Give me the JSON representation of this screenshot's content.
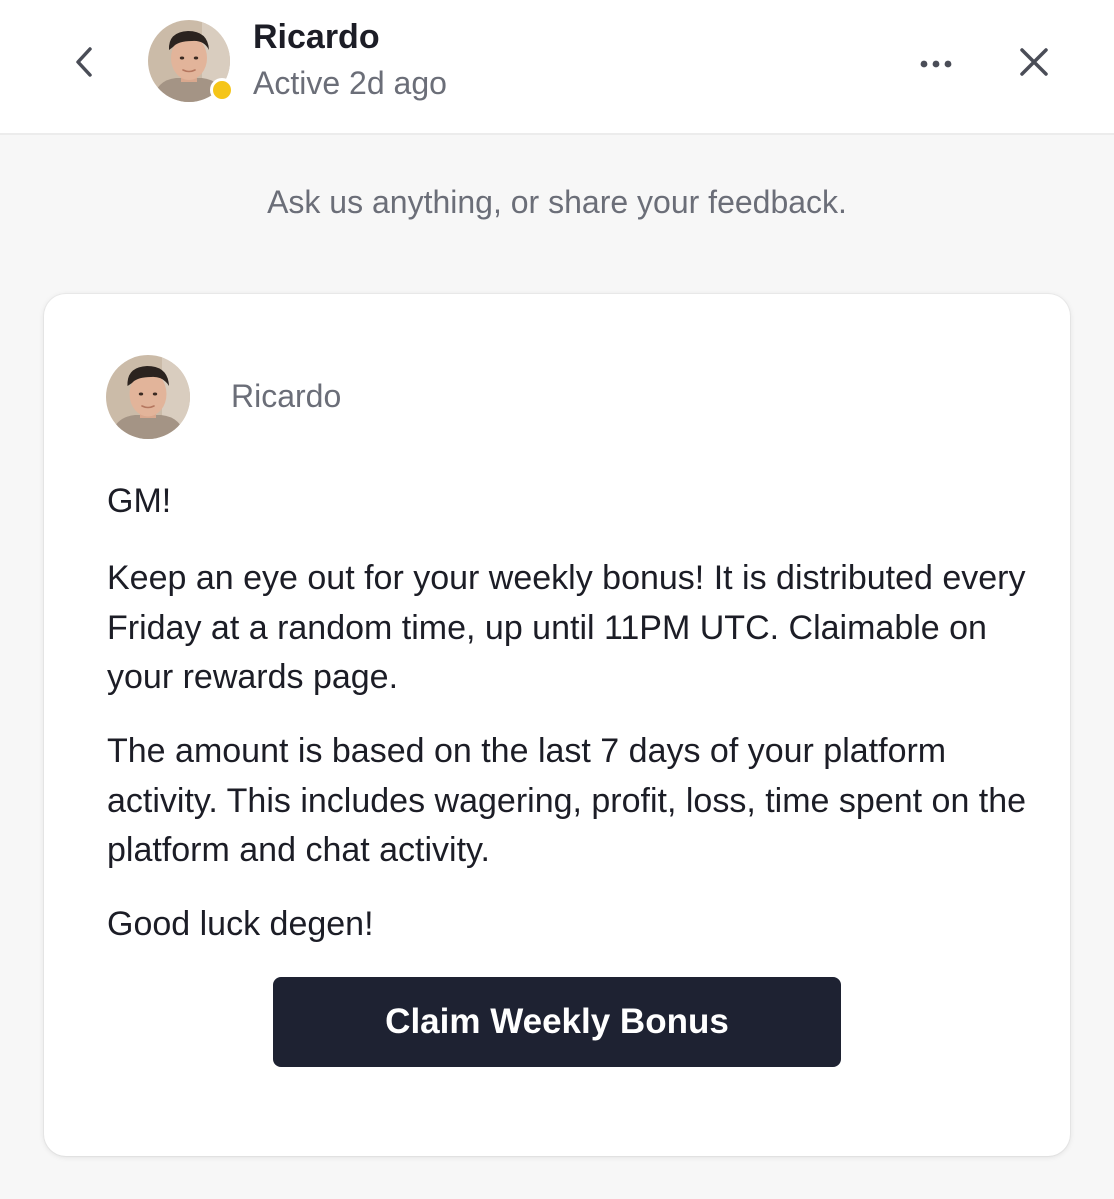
{
  "header": {
    "agent_name": "Ricardo",
    "agent_status": "Active 2d ago",
    "status_color": "#f5c518"
  },
  "intro_text": "Ask us anything, or share your feedback.",
  "message": {
    "author": "Ricardo",
    "paragraphs": [
      "GM!",
      "Keep an eye out for your weekly bonus! It is distributed every Friday at a random time, up until 11PM UTC. Claimable on your rewards page.",
      "The amount is based on the last 7 days of your platform activity. This includes wagering, profit, loss, time spent on the platform and chat activity.",
      "Good luck degen!"
    ],
    "button_label": "Claim Weekly Bonus",
    "button_color": "#1e2232"
  },
  "icons": {
    "back": "chevron-left-icon",
    "more": "ellipsis-icon",
    "close": "close-icon"
  }
}
